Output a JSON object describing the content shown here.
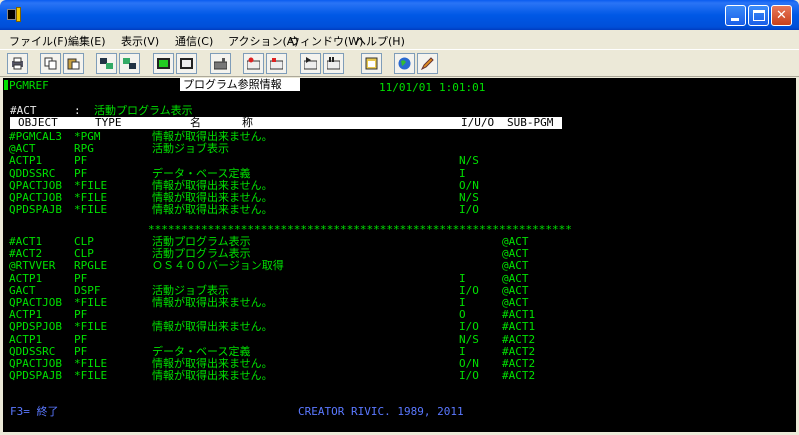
{
  "window": {
    "title": ""
  },
  "menu": [
    {
      "label": "ファイル(F)"
    },
    {
      "label": "編集(E)"
    },
    {
      "label": "表示(V)"
    },
    {
      "label": "通信(C)"
    },
    {
      "label": "アクション(A)"
    },
    {
      "label": "ウィンドウ(W)"
    },
    {
      "label": "ヘルプ(H)"
    }
  ],
  "toolbar_icons": [
    "print-icon",
    "copy-icon",
    "paste-icon",
    "send-icon",
    "receive-icon",
    "macro-icon",
    "display-icon",
    "keyboard-icon",
    "record-icon",
    "stop-icon",
    "play-icon",
    "pause-icon",
    "clipboard-icon",
    "globe-icon",
    "edit-icon"
  ],
  "terminal": {
    "program": "PGMREF",
    "pane_title": "プログラム参照情報",
    "date": "11/01/01",
    "time": "1:01:01",
    "subject_label": "#ACT",
    "subject_sep": ":",
    "subject_desc": "活動プログラム表示",
    "headers": {
      "object": "OBJECT",
      "type": "TYPE",
      "name1": "名",
      "name2": "称",
      "iuo": "I/U/O",
      "subpgm": "SUB-PGM"
    },
    "rows_top": [
      {
        "obj": "#PGMCAL3",
        "type": "*PGM",
        "name": "情報が取得出来ません。",
        "iuo": "",
        "sub": ""
      },
      {
        "obj": "@ACT",
        "type": "RPG",
        "name": "活動ジョブ表示",
        "iuo": "",
        "sub": ""
      },
      {
        "obj": "ACTP1",
        "type": "PF",
        "name": "",
        "iuo": "N/S",
        "sub": ""
      },
      {
        "obj": "QDDSSRC",
        "type": "PF",
        "name": "データ・ベース定義",
        "iuo": "I",
        "sub": ""
      },
      {
        "obj": "QPACTJOB",
        "type": "*FILE",
        "name": "情報が取得出来ません。",
        "iuo": "O/N",
        "sub": ""
      },
      {
        "obj": "QPACTJOB",
        "type": "*FILE",
        "name": "情報が取得出来ません。",
        "iuo": "N/S",
        "sub": ""
      },
      {
        "obj": "QPDSPAJB",
        "type": "*FILE",
        "name": "情報が取得出来ません。",
        "iuo": "I/O",
        "sub": ""
      }
    ],
    "separator": "****************************************************************",
    "rows_bottom": [
      {
        "obj": "#ACT1",
        "type": "CLP",
        "name": "活動プログラム表示",
        "iuo": "",
        "sub": "@ACT"
      },
      {
        "obj": "#ACT2",
        "type": "CLP",
        "name": "活動プログラム表示",
        "iuo": "",
        "sub": "@ACT"
      },
      {
        "obj": "@RTVVER",
        "type": "RPGLE",
        "name": "ＯＳ４００バージョン取得",
        "iuo": "",
        "sub": "@ACT"
      },
      {
        "obj": "ACTP1",
        "type": "PF",
        "name": "",
        "iuo": "I",
        "sub": "@ACT"
      },
      {
        "obj": "GACT",
        "type": "DSPF",
        "name": "活動ジョブ表示",
        "iuo": "I/O",
        "sub": "@ACT"
      },
      {
        "obj": "QPACTJOB",
        "type": "*FILE",
        "name": "情報が取得出来ません。",
        "iuo": "I",
        "sub": "@ACT"
      },
      {
        "obj": "ACTP1",
        "type": "PF",
        "name": "",
        "iuo": "O",
        "sub": "#ACT1"
      },
      {
        "obj": "QPDSPJOB",
        "type": "*FILE",
        "name": "情報が取得出来ません。",
        "iuo": "I/O",
        "sub": "#ACT1"
      },
      {
        "obj": "ACTP1",
        "type": "PF",
        "name": "",
        "iuo": "N/S",
        "sub": "#ACT2"
      },
      {
        "obj": "QDDSSRC",
        "type": "PF",
        "name": "データ・ベース定義",
        "iuo": "I",
        "sub": "#ACT2"
      },
      {
        "obj": "QPACTJOB",
        "type": "*FILE",
        "name": "情報が取得出来ません。",
        "iuo": "O/N",
        "sub": "#ACT2"
      },
      {
        "obj": "QPDSPAJB",
        "type": "*FILE",
        "name": "情報が取得出来ません。",
        "iuo": "I/O",
        "sub": "#ACT2"
      }
    ],
    "fkey": "F3= 終了",
    "copyright": "CREATOR RIVIC. 1989, 2011"
  }
}
